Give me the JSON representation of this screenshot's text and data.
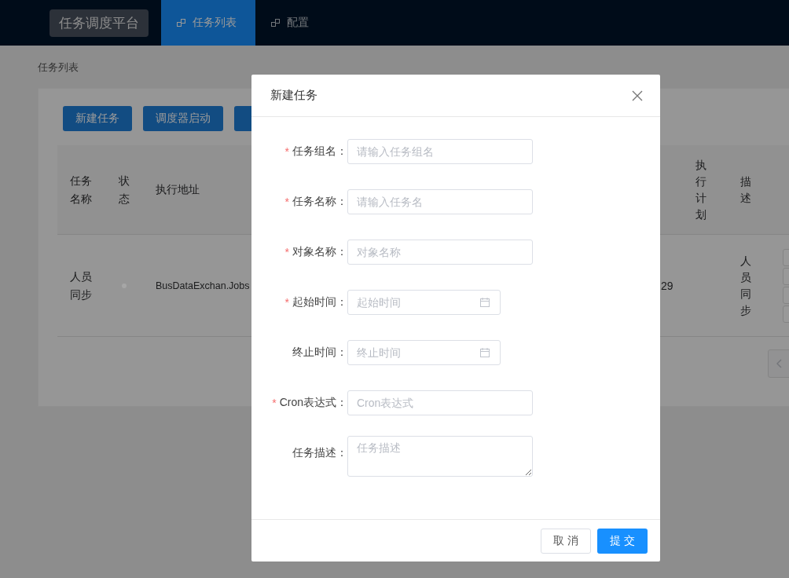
{
  "header": {
    "logo": "任务调度平台",
    "nav": [
      {
        "label": "任务列表",
        "selected": true
      },
      {
        "label": "配置",
        "selected": false
      }
    ]
  },
  "breadcrumb": "任务列表",
  "toolbar": {
    "buttons": [
      {
        "kind": "label",
        "label": "新建任务"
      },
      {
        "kind": "label",
        "label": "调度器启动"
      },
      {
        "kind": "covered"
      }
    ]
  },
  "table": {
    "columns": [
      {
        "label": "任务名称",
        "kind": "wrap"
      },
      {
        "label": "状态",
        "kind": "wrap"
      },
      {
        "label": "执行地址",
        "kind": "line"
      },
      {
        "kind": "blank"
      },
      {
        "label": "执行计划",
        "kind": "vertical"
      },
      {
        "label": "描述",
        "kind": "vertical"
      }
    ],
    "rows": [
      {
        "name": "人员同步",
        "color": "#a6a6a6",
        "address": "BusDataExchan.Jobs",
        "column_4": "29",
        "description": "人员同步"
      }
    ]
  },
  "dialog": {
    "title": "新建任务",
    "fields": [
      {
        "required_mark": "*",
        "label": "任务组名：",
        "kind": "text",
        "placeholder": "请输入任务组名"
      },
      {
        "required_mark": "*",
        "label": "任务名称：",
        "kind": "text",
        "placeholder": "请输入任务名"
      },
      {
        "required_mark": "*",
        "label": "对象名称：",
        "kind": "text",
        "placeholder": "对象名称"
      },
      {
        "required_mark": "*",
        "label": "起始时间：",
        "kind": "date",
        "placeholder": "起始时间"
      },
      {
        "label": "终止时间：",
        "kind": "date",
        "placeholder": "终止时间"
      },
      {
        "required_mark": "*",
        "label": "Cron表达式：",
        "kind": "text",
        "placeholder": "Cron表达式"
      },
      {
        "label": "任务描述：",
        "kind": "textarea",
        "placeholder": "任务描述"
      }
    ],
    "cancel": "取 消",
    "submit": "提 交"
  }
}
